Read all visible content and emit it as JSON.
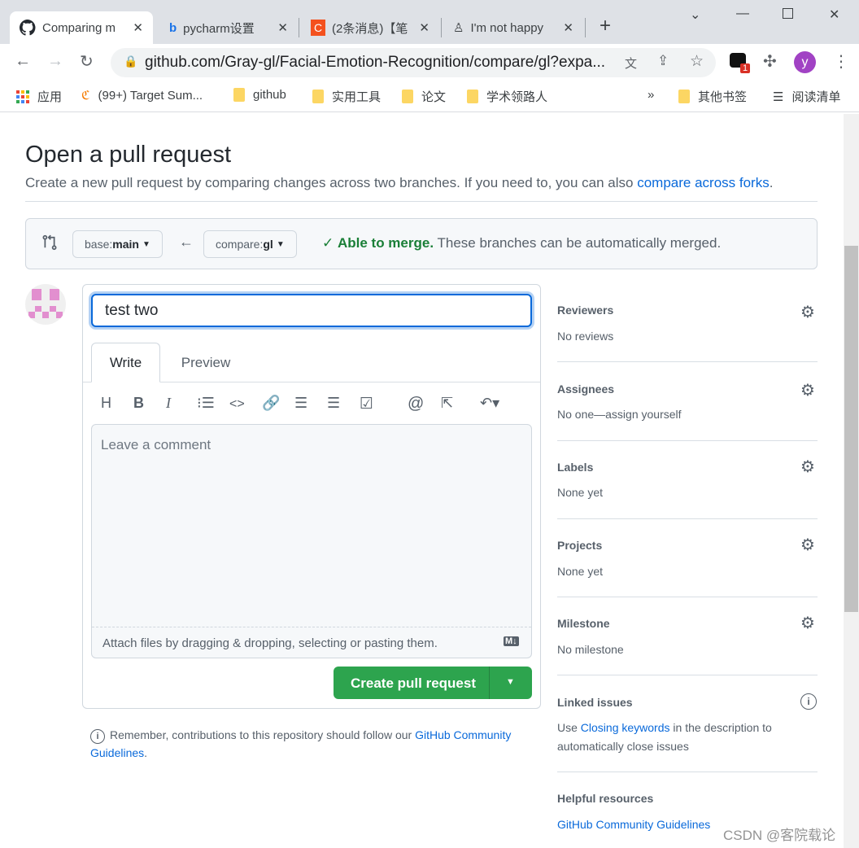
{
  "browser": {
    "tabs": [
      {
        "title": "Comparing m",
        "icon": "github-icon"
      },
      {
        "title": "pycharm设置",
        "icon": "bing-icon"
      },
      {
        "title": "(2条消息)【笔",
        "icon": "csdn-icon"
      },
      {
        "title": "I'm not happy",
        "icon": "page-icon"
      }
    ],
    "url": "github.com/Gray-gl/Facial-Emotion-Recognition/compare/gl?expa...",
    "profile_initial": "y",
    "extension_badge": "1",
    "bookmarks": [
      {
        "label": "应用",
        "icon": "apps-icon"
      },
      {
        "label": "(99+) Target Sum...",
        "icon": "site-icon"
      },
      {
        "label": "github",
        "icon": "folder-icon"
      },
      {
        "label": "实用工具",
        "icon": "folder-icon"
      },
      {
        "label": "论文",
        "icon": "folder-icon"
      },
      {
        "label": "学术领路人",
        "icon": "folder-icon"
      }
    ],
    "overflow": "»",
    "other_bookmarks": "其他书签",
    "reading_list": "阅读清单"
  },
  "page": {
    "title": "Open a pull request",
    "subtitle": "Create a new pull request by comparing changes across two branches. If you need to, you can also ",
    "subtitle_link": "compare across forks",
    "subtitle_end": ".",
    "base_prefix": "base: ",
    "base": "main",
    "compare_prefix": "compare: ",
    "compare": "gl",
    "merge_status": "Able to merge.",
    "merge_text": " These branches can be automatically merged.",
    "colors": {
      "accent": "#0969da",
      "success": "#2da44e",
      "merge_text": "#1a7f37"
    }
  },
  "form": {
    "title_value": "test two",
    "tabs": [
      "Write",
      "Preview"
    ],
    "comment_placeholder": "Leave a comment",
    "attach_text": "Attach files by dragging & dropping, selecting or pasting them.",
    "markdown_badge": "M↓",
    "submit": "Create pull request",
    "note": "Remember, contributions to this repository should follow our ",
    "note_link": "GitHub Community Guidelines",
    "note_end": "."
  },
  "sidebar": {
    "reviewers": {
      "title": "Reviewers",
      "value": "No reviews"
    },
    "assignees": {
      "title": "Assignees",
      "value": "No one—assign yourself"
    },
    "labels": {
      "title": "Labels",
      "value": "None yet"
    },
    "projects": {
      "title": "Projects",
      "value": "None yet"
    },
    "milestone": {
      "title": "Milestone",
      "value": "No milestone"
    },
    "linked": {
      "title": "Linked issues",
      "pre": "Use ",
      "link": "Closing keywords",
      "post": " in the description to automatically close issues"
    },
    "helpful": {
      "title": "Helpful resources",
      "link": "GitHub Community Guidelines"
    }
  },
  "watermark": "CSDN @客院载论"
}
